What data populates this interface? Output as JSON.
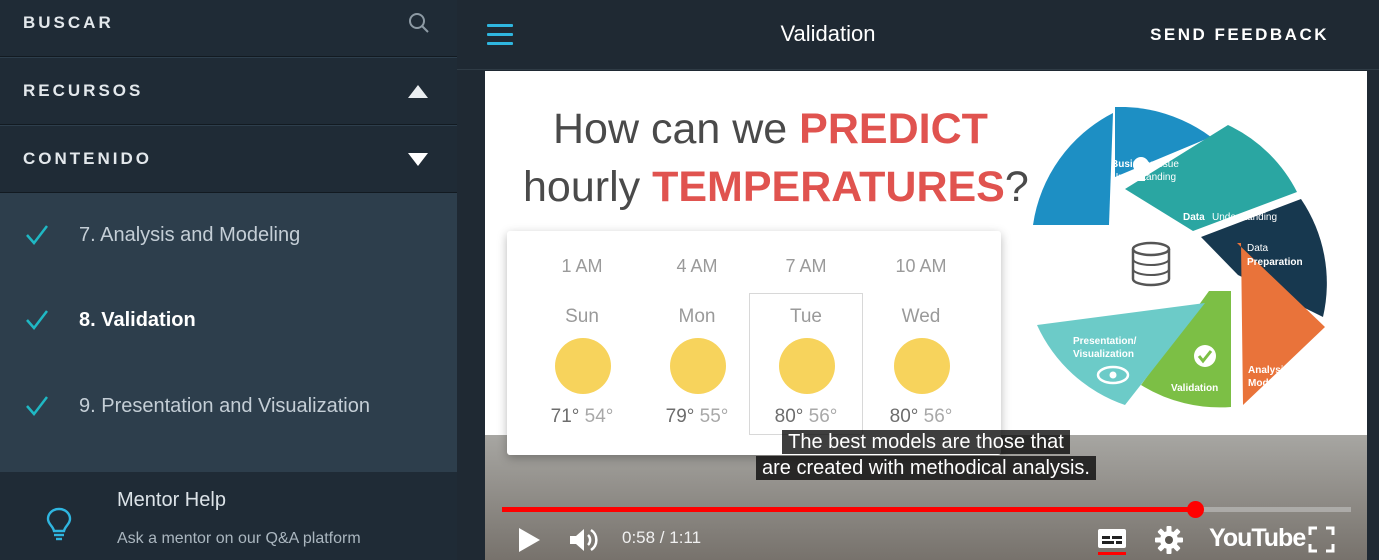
{
  "sidebar": {
    "search_label": "BUSCAR",
    "resources_label": "RECURSOS",
    "content_label": "CONTENIDO",
    "lessons": [
      {
        "label": "7. Analysis and Modeling",
        "done": true,
        "active": false
      },
      {
        "label": "8. Validation",
        "done": true,
        "active": true
      },
      {
        "label": "9. Presentation and Visualization",
        "done": true,
        "active": false
      }
    ],
    "mentor": {
      "title": "Mentor Help",
      "subtitle": "Ask a mentor on our Q&A platform"
    }
  },
  "header": {
    "title": "Validation",
    "feedback_label": "SEND FEEDBACK"
  },
  "video": {
    "slide": {
      "line1_plain": "How can we ",
      "line1_bold": "PREDICT",
      "line2_plain": "hourly ",
      "line2_bold": "TEMPERATURES",
      "line2_end": "?"
    },
    "forecast": [
      {
        "time": "1 AM",
        "day": "Sun",
        "high": "71°",
        "low": "54°"
      },
      {
        "time": "4 AM",
        "day": "Mon",
        "high": "79°",
        "low": "55°"
      },
      {
        "time": "7 AM",
        "day": "Tue",
        "high": "80°",
        "low": "56°"
      },
      {
        "time": "10 AM",
        "day": "Wed",
        "high": "80°",
        "low": "56°"
      }
    ],
    "cycle_labels": {
      "business_1": "Business",
      "business_2": "Issue",
      "business_3": "Understanding",
      "data_und_1": "Data",
      "data_und_2": "Understanding",
      "data_prep_1": "Data",
      "data_prep_2": "Preparation",
      "analysis_1": "Analysis/",
      "analysis_2": "Modeling",
      "validation": "Validation",
      "presentation_1": "Presentation/",
      "presentation_2": "Visualization"
    },
    "subtitles": [
      "The best models are those that",
      "are created with methodical analysis."
    ],
    "time_display": "0:58 / 1:11",
    "progress": 0.816,
    "brand": "YouTube"
  },
  "colors": {
    "accent_blue": "#2fb6e0",
    "check_teal": "#1fb8c4",
    "red": "#ff0000",
    "slide_red": "#e0534f"
  }
}
